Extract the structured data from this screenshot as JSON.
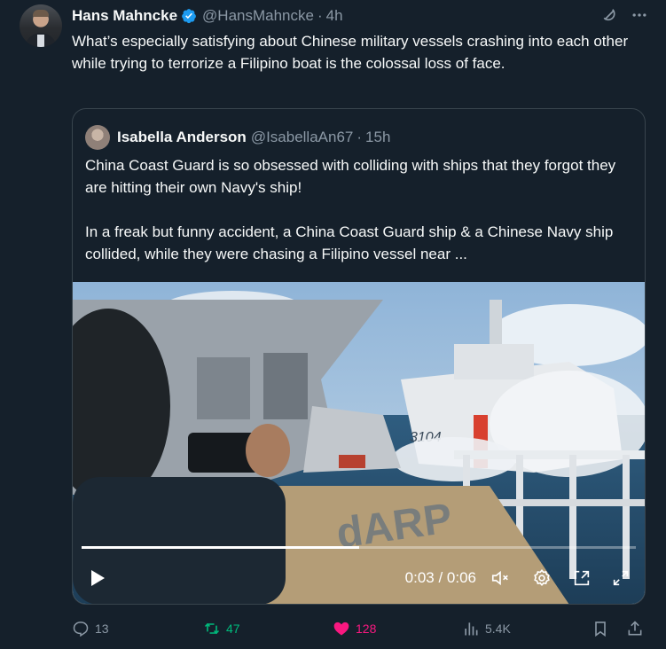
{
  "post": {
    "author_name": "Hans Mahncke",
    "author_handle": "@HansMahncke",
    "separator": "·",
    "time": "4h",
    "text": "What’s especially satisfying about Chinese military vessels crashing into each other while trying to terrorize a Filipino boat is the colossal loss of face."
  },
  "quote": {
    "author_name": "Isabella Anderson",
    "author_handle": "@IsabellaAn67",
    "separator": "·",
    "time": "15h",
    "paragraph1": "China Coast Guard is so obsessed with colliding with ships that they forgot they are hitting their own Navy's ship!",
    "paragraph2": "In a freak but funny accident, a China Coast Guard ship & a Chinese Navy ship collided, while they were chasing a Filipino vessel near ...",
    "video": {
      "time_readout": "0:03 / 0:06",
      "progress_fraction": 0.5,
      "hull_number": "3104"
    }
  },
  "actions": {
    "replies": "13",
    "reposts": "47",
    "likes": "128",
    "views": "5.4K"
  },
  "colors": {
    "background": "#15202b",
    "verified": "#1d9bf0",
    "repost_active": "#00ba7c",
    "like_active": "#f91880",
    "muted_text": "#8b98a5"
  },
  "icons": [
    "verified-badge-icon",
    "grok-icon",
    "more-icon",
    "play-icon",
    "mute-icon",
    "settings-icon",
    "pip-icon",
    "fullscreen-icon",
    "reply-icon",
    "repost-icon",
    "like-icon",
    "views-icon",
    "bookmark-icon",
    "share-icon"
  ]
}
